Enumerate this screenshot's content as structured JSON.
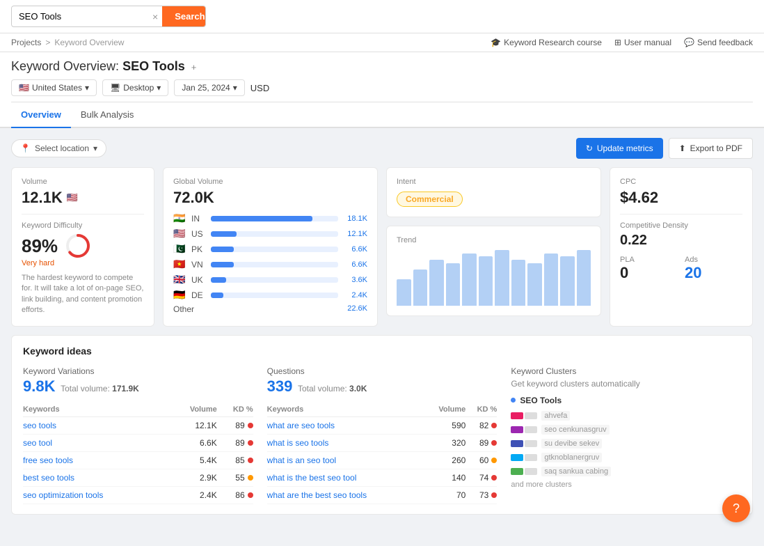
{
  "topbar": {
    "search_value": "SEO Tools",
    "search_placeholder": "Search",
    "search_button_label": "Search",
    "clear_icon": "×"
  },
  "header": {
    "breadcrumb": {
      "projects": "Projects",
      "separator": ">",
      "current": "Keyword Overview"
    },
    "actions": {
      "course": "Keyword Research course",
      "manual": "User manual",
      "feedback": "Send feedback"
    },
    "title_prefix": "Keyword Overview:",
    "title_keyword": "SEO Tools",
    "add_icon": "+",
    "filters": {
      "country": "United States",
      "device": "Desktop",
      "date": "Jan 25, 2024",
      "currency": "USD"
    }
  },
  "tabs": [
    {
      "label": "Overview",
      "active": true
    },
    {
      "label": "Bulk Analysis",
      "active": false
    }
  ],
  "location": {
    "placeholder": "Select location",
    "update_btn": "Update metrics",
    "export_btn": "Export to PDF"
  },
  "metrics": {
    "volume": {
      "label": "Volume",
      "value": "12.1K",
      "flag": "🇺🇸"
    },
    "keyword_difficulty": {
      "label": "Keyword Difficulty",
      "value": "89%",
      "rating": "Very hard",
      "description": "The hardest keyword to compete for. It will take a lot of on-page SEO, link building, and content promotion efforts.",
      "gauge_pct": 89
    },
    "global_volume": {
      "label": "Global Volume",
      "value": "72.0K",
      "rows": [
        {
          "flag": "🇮🇳",
          "code": "IN",
          "pct": 80,
          "value": "18.1K"
        },
        {
          "flag": "🇺🇸",
          "code": "US",
          "pct": 20,
          "value": "12.1K"
        },
        {
          "flag": "🇵🇰",
          "code": "PK",
          "pct": 18,
          "value": "6.6K"
        },
        {
          "flag": "🇻🇳",
          "code": "VN",
          "pct": 18,
          "value": "6.6K"
        },
        {
          "flag": "🇬🇧",
          "code": "UK",
          "pct": 12,
          "value": "3.6K"
        },
        {
          "flag": "🇩🇪",
          "code": "DE",
          "pct": 10,
          "value": "2.4K"
        }
      ],
      "other_label": "Other",
      "other_value": "22.6K"
    },
    "intent": {
      "label": "Intent",
      "badge": "Commercial"
    },
    "trend": {
      "label": "Trend",
      "bars": [
        40,
        55,
        70,
        65,
        80,
        75,
        85,
        70,
        65,
        80,
        75,
        85
      ]
    },
    "cpc": {
      "label": "CPC",
      "value": "$4.62"
    },
    "competitive_density": {
      "label": "Competitive Density",
      "value": "0.22"
    },
    "pla": {
      "label": "PLA",
      "value": "0"
    },
    "ads": {
      "label": "Ads",
      "value": "20"
    }
  },
  "keyword_ideas": {
    "title": "Keyword ideas",
    "variations": {
      "section_title": "Keyword Variations",
      "count": "9.8K",
      "total_label": "Total volume:",
      "total_value": "171.9K",
      "col_keywords": "Keywords",
      "col_volume": "Volume",
      "col_kd": "KD %",
      "rows": [
        {
          "keyword": "seo tools",
          "volume": "12.1K",
          "kd": "89",
          "dot": "red"
        },
        {
          "keyword": "seo tool",
          "volume": "6.6K",
          "kd": "89",
          "dot": "red"
        },
        {
          "keyword": "free seo tools",
          "volume": "5.4K",
          "kd": "85",
          "dot": "red"
        },
        {
          "keyword": "best seo tools",
          "volume": "2.9K",
          "kd": "55",
          "dot": "orange"
        },
        {
          "keyword": "seo optimization tools",
          "volume": "2.4K",
          "kd": "86",
          "dot": "red"
        }
      ]
    },
    "questions": {
      "section_title": "Questions",
      "count": "339",
      "total_label": "Total volume:",
      "total_value": "3.0K",
      "col_keywords": "Keywords",
      "col_volume": "Volume",
      "col_kd": "KD %",
      "rows": [
        {
          "keyword": "what are seo tools",
          "volume": "590",
          "kd": "82",
          "dot": "red"
        },
        {
          "keyword": "what is seo tools",
          "volume": "320",
          "kd": "89",
          "dot": "red"
        },
        {
          "keyword": "what is an seo tool",
          "volume": "260",
          "kd": "60",
          "dot": "orange"
        },
        {
          "keyword": "what is the best seo tool",
          "volume": "140",
          "kd": "74",
          "dot": "red"
        },
        {
          "keyword": "what are the best seo tools",
          "volume": "70",
          "kd": "73",
          "dot": "red"
        }
      ]
    },
    "clusters": {
      "section_title": "Keyword Clusters",
      "auto_text": "Get keyword clusters automatically",
      "main_cluster": "SEO Tools",
      "sub_clusters": [
        {
          "label": "ahvefa"
        },
        {
          "label": "seo cenkunasgruv"
        },
        {
          "label": "su devibe sekev"
        },
        {
          "label": "gtknoblanergruv"
        },
        {
          "label": "saq sankua cabing"
        }
      ],
      "more": "and more clusters"
    }
  },
  "help_btn": "?"
}
